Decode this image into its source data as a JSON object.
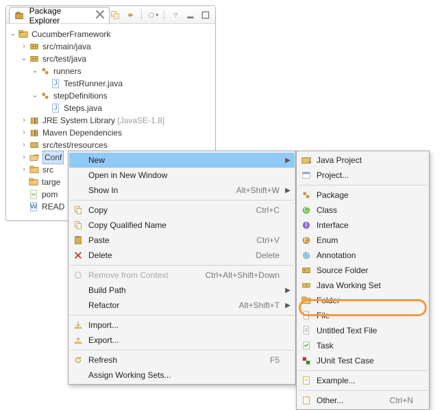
{
  "panel": {
    "title": "Package Explorer",
    "project": "CucumberFramework",
    "srcMainJava": "src/main/java",
    "srcTestJava": "src/test/java",
    "runnersPkg": "runners",
    "testRunner": "TestRunner.java",
    "stepDefPkg": "stepDefinitions",
    "steps": "Steps.java",
    "jre": "JRE System Library",
    "jreVer": "[JavaSE-1.8]",
    "maven": "Maven Dependencies",
    "srcTestRes": "src/test/resources",
    "conf": "Conf",
    "src": "src",
    "target": "targe",
    "pom": "pom",
    "readme": "READ"
  },
  "ctx": {
    "new": "New",
    "openWin": "Open in New Window",
    "showIn": "Show In",
    "showInHint": "Alt+Shift+W",
    "copy": "Copy",
    "copyHint": "Ctrl+C",
    "copyQ": "Copy Qualified Name",
    "paste": "Paste",
    "pasteHint": "Ctrl+V",
    "delete": "Delete",
    "deleteHint": "Delete",
    "remove": "Remove from Context",
    "removeHint": "Ctrl+Alt+Shift+Down",
    "buildPath": "Build Path",
    "refactor": "Refactor",
    "refactorHint": "Alt+Shift+T",
    "import": "Import...",
    "export": "Export...",
    "refresh": "Refresh",
    "refreshHint": "F5",
    "aws": "Assign Working Sets..."
  },
  "nw": {
    "javaProject": "Java Project",
    "project": "Project...",
    "package": "Package",
    "class": "Class",
    "interface": "Interface",
    "enum": "Enum",
    "annotation": "Annotation",
    "sourceFolder": "Source Folder",
    "jws": "Java Working Set",
    "folder": "Folder",
    "file": "File",
    "utf": "Untitled Text File",
    "task": "Task",
    "junit": "JUnit Test Case",
    "example": "Example...",
    "other": "Other...",
    "otherHint": "Ctrl+N"
  }
}
